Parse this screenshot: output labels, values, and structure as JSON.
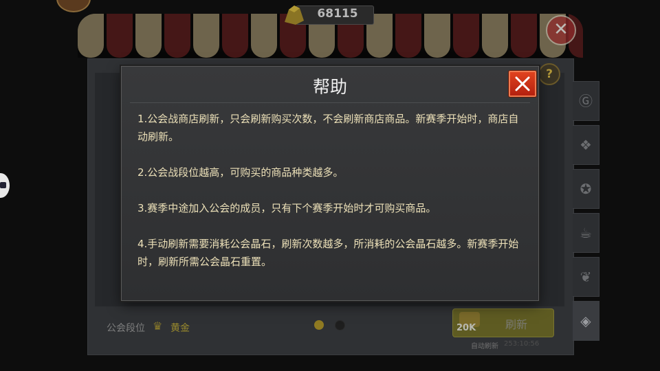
{
  "currency": {
    "icon": "gold-coin-pile-icon",
    "value": "68115"
  },
  "shop": {
    "guild_rank_label": "公会段位",
    "guild_rank_icon": "rank-shield-icon",
    "guild_rank_value": "黄金",
    "refresh_button_label": "刷新",
    "refresh_cost": "20K",
    "auto_refresh_label": "自动刷新",
    "auto_refresh_time": "253:10:56",
    "page_indicator": {
      "pages": 2,
      "current": 1
    },
    "side_tabs": [
      {
        "icon": "gold-g-coin-icon"
      },
      {
        "icon": "gear-token-icon"
      },
      {
        "icon": "medal-icon"
      },
      {
        "icon": "beer-mug-icon"
      },
      {
        "icon": "leaf-icon"
      },
      {
        "icon": "guild-crystal-icon"
      }
    ]
  },
  "help_dialog": {
    "title": "帮助",
    "close_icon": "close-x-icon",
    "paragraphs": [
      "1.公会战商店刷新，只会刷新购买次数，不会刷新商店商品。新赛季开始时，商店自动刷新。",
      "2.公会战段位越高，可购买的商品种类越多。",
      "3.赛季中途加入公会的成员，只有下个赛季开始时才可购买商品。",
      "4.手动刷新需要消耗公会晶石，刷新次数越多，所消耗的公会晶石越多。新赛季开始时，刷新所需公会晶石重置。"
    ]
  },
  "colors": {
    "dialog_text": "#ece0b8",
    "close_button": "#d2351a",
    "rank_gold": "#9a8a2c"
  }
}
